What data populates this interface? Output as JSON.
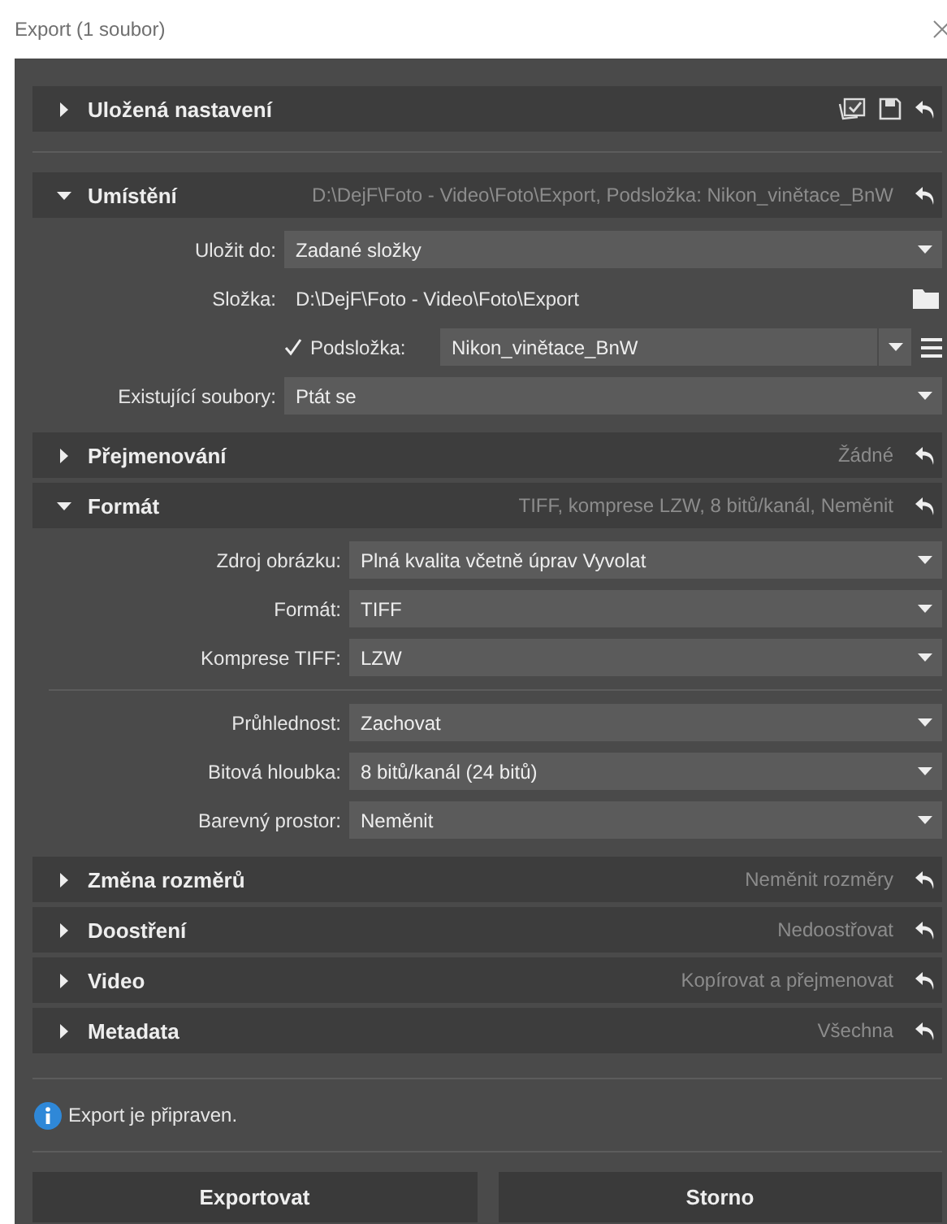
{
  "window": {
    "title": "Export (1 soubor)"
  },
  "presets": {
    "title": "Uložená nastavení",
    "expanded": false
  },
  "sections": [
    {
      "title": "Umístění",
      "expanded": true,
      "summary": "D:\\DejF\\Foto - Video\\Foto\\Export, Podsložka: Nikon_vinětace_BnW",
      "field_groups": [
        [
          {
            "kind": "dropdown",
            "label": "Uložit do:",
            "value": "Zadané složky"
          },
          {
            "kind": "path",
            "label": "Složka:",
            "value": "D:\\DejF\\Foto - Video\\Foto\\Export"
          },
          {
            "kind": "subfolder",
            "label": "Podsložka:",
            "checked": true,
            "value": "Nikon_vinětace_BnW"
          },
          {
            "kind": "dropdown",
            "label": "Existující soubory:",
            "value": "Ptát se"
          }
        ]
      ]
    },
    {
      "title": "Přejmenování",
      "expanded": false,
      "summary": "Žádné"
    },
    {
      "title": "Formát",
      "expanded": true,
      "summary": "TIFF, komprese LZW, 8 bitů/kanál, Neměnit",
      "field_groups": [
        [
          {
            "kind": "dropdown",
            "label": "Zdroj obrázku:",
            "value": "Plná kvalita včetně úprav Vyvolat"
          },
          {
            "kind": "dropdown",
            "label": "Formát:",
            "value": "TIFF"
          },
          {
            "kind": "dropdown",
            "label": "Komprese TIFF:",
            "value": "LZW"
          }
        ],
        [
          {
            "kind": "dropdown",
            "label": "Průhlednost:",
            "value": "Zachovat"
          },
          {
            "kind": "dropdown",
            "label": "Bitová hloubka:",
            "value": "8 bitů/kanál (24 bitů)"
          },
          {
            "kind": "dropdown",
            "label": "Barevný prostor:",
            "value": "Neměnit"
          }
        ]
      ]
    },
    {
      "title": "Změna rozměrů",
      "expanded": false,
      "summary": "Neměnit rozměry"
    },
    {
      "title": "Doostření",
      "expanded": false,
      "summary": "Nedoostřovat"
    },
    {
      "title": "Video",
      "expanded": false,
      "summary": "Kopírovat a přejmenovat"
    },
    {
      "title": "Metadata",
      "expanded": false,
      "summary": "Všechna"
    }
  ],
  "status": {
    "message": "Export je připraven."
  },
  "buttons": [
    "Exportovat",
    "Storno"
  ]
}
